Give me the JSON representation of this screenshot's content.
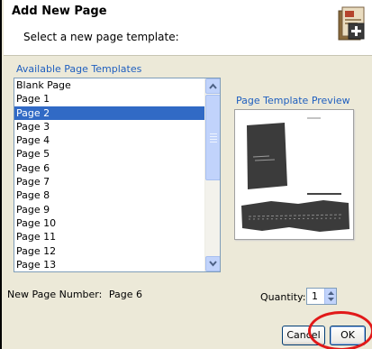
{
  "dialog": {
    "title": "Add New Page",
    "subtitle": "Select a new page template:",
    "icon": "add-page-icon"
  },
  "templates": {
    "section_label": "Available Page Templates",
    "selected": "Page 2",
    "items": [
      {
        "label": "Blank Page"
      },
      {
        "label": "Page 1"
      },
      {
        "label": "Page 2"
      },
      {
        "label": "Page 3"
      },
      {
        "label": "Page 4"
      },
      {
        "label": "Page 5"
      },
      {
        "label": "Page 6"
      },
      {
        "label": "Page 7"
      },
      {
        "label": "Page 8"
      },
      {
        "label": "Page 9"
      },
      {
        "label": "Page 10"
      },
      {
        "label": "Page 11"
      },
      {
        "label": "Page 12"
      },
      {
        "label": "Page 13"
      }
    ]
  },
  "preview": {
    "label": "Page Template Preview"
  },
  "footer": {
    "page_number_label": "New Page Number:",
    "page_number_value": "Page 6",
    "quantity_label": "Quantity:",
    "quantity_value": "1"
  },
  "buttons": {
    "cancel": "Cancel",
    "ok": "OK"
  },
  "colors": {
    "accent_text": "#1f5fbf",
    "selection": "#316ac5",
    "annotation": "#e11919"
  }
}
